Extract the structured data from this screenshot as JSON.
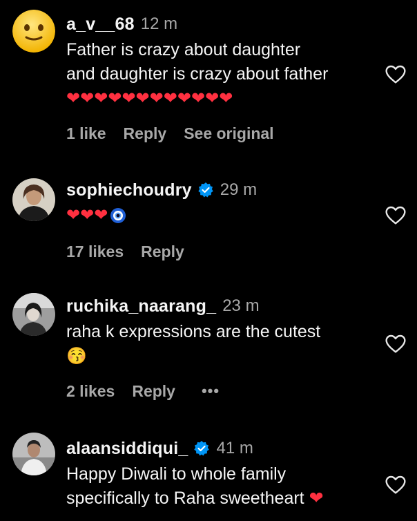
{
  "comments": [
    {
      "username": "a_v__68",
      "time": "12 m",
      "text": "Father is crazy about daughter\nand daughter is crazy about father",
      "hearts": "❤❤❤❤❤❤❤❤❤❤❤❤",
      "likes": "1 like",
      "reply": "Reply",
      "extra": "See original",
      "avatar_icon": "slightly-smiling-face-emoji"
    },
    {
      "username": "sophiechoudry",
      "verified": true,
      "time": "29 m",
      "hearts": "❤❤❤",
      "extra_emoji": "nazar-amulet-emoji",
      "likes": "17 likes",
      "reply": "Reply"
    },
    {
      "username": "ruchika_naarang_",
      "time": "23 m",
      "text": "raha k expressions are the cutest",
      "emoji": "😚",
      "likes": "2 likes",
      "reply": "Reply",
      "more": "•••"
    },
    {
      "username": "alaansiddiqui_",
      "verified": true,
      "time": "41 m",
      "text": "Happy Diwali to whole family\nspecifically to Raha sweetheart",
      "trailing_emoji": "❤"
    }
  ],
  "colors": {
    "background": "#000000",
    "text": "#f5f5f5",
    "muted": "#a8a8a8",
    "verified": "#0095f6",
    "heart": "#ff3040"
  }
}
